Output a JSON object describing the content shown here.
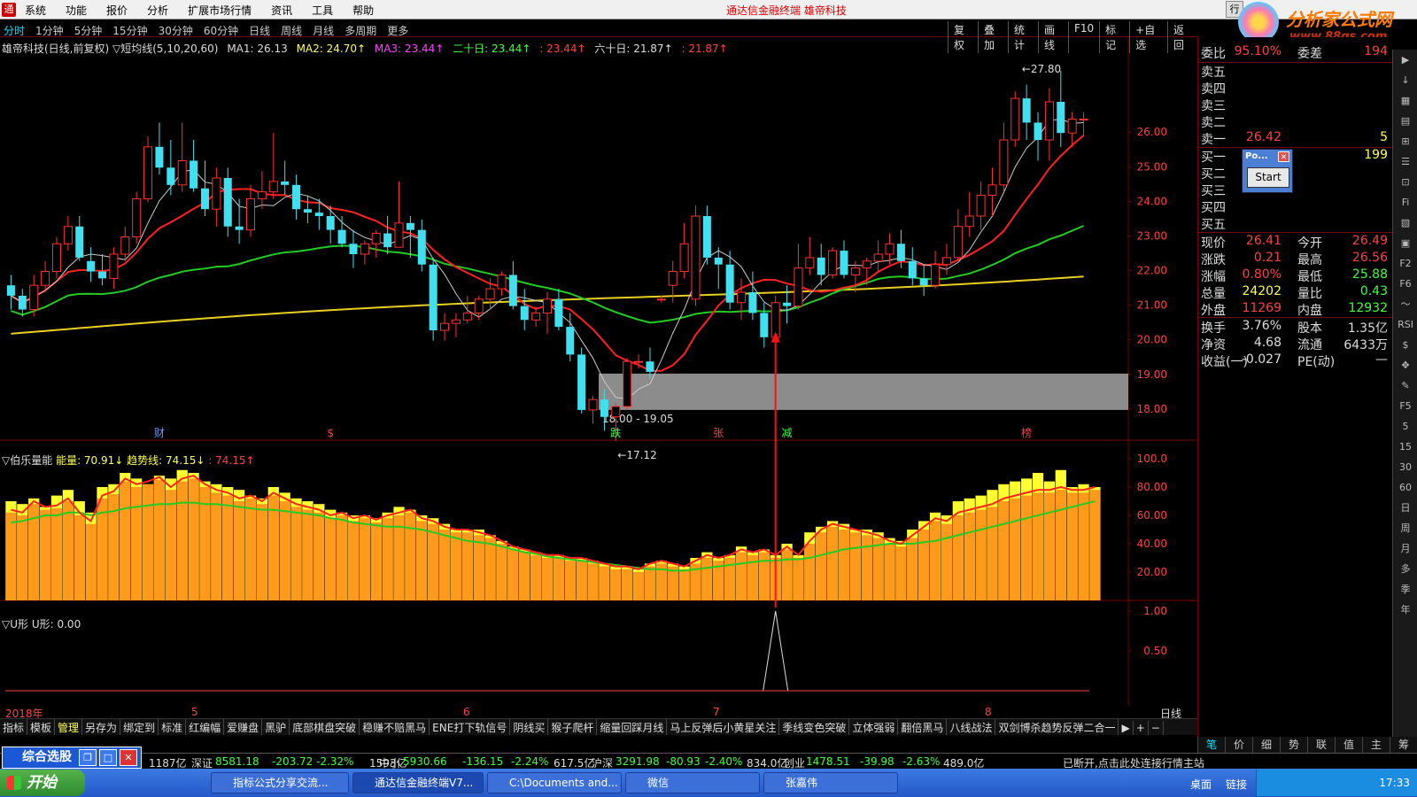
{
  "titlebar": {
    "menu": [
      "系统",
      "功能",
      "报价",
      "分析",
      "扩展市场行情",
      "资讯",
      "工具",
      "帮助"
    ],
    "title": "通达信金融终端  雄帝科技",
    "right_label": "行"
  },
  "brand": {
    "name": "分析家公式网",
    "url": "www.88gs.com"
  },
  "tabrow": {
    "periods": [
      "分时",
      "1分钟",
      "5分钟",
      "15分钟",
      "30分钟",
      "60分钟",
      "日线",
      "周线",
      "月线",
      "多周期",
      "更多"
    ],
    "ops": [
      "复权",
      "叠加",
      "统计",
      "画线",
      "F10",
      "标记",
      "+自选",
      "返回"
    ]
  },
  "chart_info": {
    "title": "雄帝科技(日线,前复权) ▽短均线(5,10,20,60)",
    "ma1": "MA1: 26.13",
    "ma2": "MA2: 24.70↑",
    "ma3": "MA3: 23.44↑",
    "ma20": "二十日: 23.44↑",
    "ma20b": ": 23.44↑",
    "ma60": "六十日: 21.87↑",
    "ma60b": ": 21.87↑"
  },
  "price_axis": [
    "26.00",
    "25.00",
    "24.00",
    "23.00",
    "22.00",
    "21.00",
    "20.00",
    "19.00",
    "18.00"
  ],
  "annotations": {
    "high": "27.80",
    "low": "17.12",
    "zone": "18.00 - 19.05",
    "markers": [
      "财",
      "$",
      "跌",
      "张",
      "减",
      "榜"
    ]
  },
  "ind1": {
    "title": "▽伯乐量能",
    "energy": "能量: 70.91↓",
    "trend": "趋势线: 74.15↓",
    "trend2": ": 74.15↑",
    "axis": [
      "100.0",
      "80.00",
      "60.00",
      "40.00",
      "20.00"
    ]
  },
  "ind2": {
    "title": "▽U形",
    "value": "U形: 0.00",
    "axis": [
      "1.00",
      "0.50"
    ]
  },
  "dates": {
    "labels": [
      "2018年",
      "5",
      "6",
      "7",
      "8"
    ],
    "period": "日线"
  },
  "indicator_tabs": [
    "指标",
    "模板",
    "管理",
    "另存为",
    "绑定到",
    "标准",
    "红编幅",
    "爱赚盘",
    "黑驴",
    "底部棋盘突破",
    "稳赚不赔黑马",
    "ENE打下轨信号",
    "阴线买",
    "猴子爬杆",
    "缩量回踩月线",
    "马上反弹后小黄星关注",
    "季线变色突破",
    "立体强弱",
    "翻倍黑马",
    "八线战法",
    "双剑博杀趋势反弹二合一",
    "▶",
    "+",
    "−"
  ],
  "quote": {
    "weibi": {
      "label": "委比",
      "value": "95.10%",
      "label2": "委差",
      "value2": "194"
    },
    "sell": [
      {
        "label": "卖五",
        "price": "",
        "vol": ""
      },
      {
        "label": "卖四",
        "price": "",
        "vol": ""
      },
      {
        "label": "卖三",
        "price": "",
        "vol": ""
      },
      {
        "label": "卖二",
        "price": "",
        "vol": ""
      },
      {
        "label": "卖一",
        "price": "26.42",
        "vol": "5"
      }
    ],
    "buy": [
      {
        "label": "买一",
        "price": "",
        "vol": "199"
      },
      {
        "label": "买二",
        "price": "",
        "vol": ""
      },
      {
        "label": "买三",
        "price": "",
        "vol": ""
      },
      {
        "label": "买四",
        "price": "",
        "vol": ""
      },
      {
        "label": "买五",
        "price": "",
        "vol": ""
      }
    ],
    "stats": [
      {
        "l": "现价",
        "v": "26.41",
        "l2": "今开",
        "v2": "26.49",
        "c": "#ff4040",
        "c2": "#ff4040"
      },
      {
        "l": "涨跌",
        "v": "0.21",
        "l2": "最高",
        "v2": "26.56",
        "c": "#ff4040",
        "c2": "#ff4040"
      },
      {
        "l": "涨幅",
        "v": "0.80%",
        "l2": "最低",
        "v2": "25.88",
        "c": "#ff4040",
        "c2": "#40ff40"
      },
      {
        "l": "总量",
        "v": "24202",
        "l2": "量比",
        "v2": "0.43",
        "c": "#ffff55",
        "c2": "#40ff40"
      },
      {
        "l": "外盘",
        "v": "11269",
        "l2": "内盘",
        "v2": "12932",
        "c": "#ff4040",
        "c2": "#40ff40"
      }
    ],
    "stats2": [
      {
        "l": "换手",
        "v": "3.76%",
        "l2": "股本",
        "v2": "1.35亿",
        "c": "#ddd",
        "c2": "#ddd"
      },
      {
        "l": "净资",
        "v": "4.68",
        "l2": "流通",
        "v2": "6433万",
        "c": "#ddd",
        "c2": "#ddd"
      },
      {
        "l": "收益(一)",
        "v": "-0.027",
        "l2": "PE(动)",
        "v2": "—",
        "c": "#ddd",
        "c2": "#ddd"
      }
    ]
  },
  "popup": {
    "title": "Po...",
    "button": "Start"
  },
  "right_tools": [
    "▶",
    "↓",
    "▦",
    "▤",
    "⊞",
    "☰",
    "⊡",
    "Fi",
    "▧",
    "▣",
    "F2",
    "F6",
    "〜",
    "RSI",
    "$",
    "✥",
    "✎",
    "F5",
    "5",
    "15",
    "30",
    "60",
    "日",
    "周",
    "月",
    "多",
    "季",
    "年"
  ],
  "quote_tabs": [
    "笔",
    "价",
    "细",
    "势",
    "联",
    "值",
    "主",
    "筹"
  ],
  "ticker": [
    {
      "t": "1187亿",
      "c": "#ddd"
    },
    {
      "t": "深证",
      "c": "#ddd"
    },
    {
      "t": "8581.18",
      "c": "#40ff40"
    },
    {
      "t": "-203.72",
      "c": "#40ff40"
    },
    {
      "t": "-2.32%",
      "c": "#40ff40"
    },
    {
      "t": "1593亿",
      "c": "#ddd"
    },
    {
      "t": "中小",
      "c": "#ddd"
    },
    {
      "t": "5930.66",
      "c": "#40ff40"
    },
    {
      "t": "-136.15",
      "c": "#40ff40"
    },
    {
      "t": "-2.24%",
      "c": "#40ff40"
    },
    {
      "t": "617.5亿",
      "c": "#ddd"
    },
    {
      "t": "沪深",
      "c": "#ddd"
    },
    {
      "t": "3291.98",
      "c": "#40ff40"
    },
    {
      "t": "-80.93",
      "c": "#40ff40"
    },
    {
      "t": "-2.40%",
      "c": "#40ff40"
    },
    {
      "t": "834.0亿",
      "c": "#ddd"
    },
    {
      "t": "创业",
      "c": "#ddd"
    },
    {
      "t": "1478.51",
      "c": "#40ff40"
    },
    {
      "t": "-39.98",
      "c": "#40ff40"
    },
    {
      "t": "-2.63%",
      "c": "#40ff40"
    },
    {
      "t": "489.0亿",
      "c": "#ddd"
    },
    {
      "t": "已断开,点击此处连接行情主站",
      "c": "#ddd"
    }
  ],
  "xuangu": {
    "title": "综合选股"
  },
  "taskbar": {
    "start": "开始",
    "tasks": [
      "指标公式分享交流...",
      "通达信金融终端V7...",
      "C:\\Documents and...",
      "微信",
      "张嘉伟"
    ],
    "tray_labels": [
      "桌面",
      "链接"
    ],
    "clock": "17:33"
  },
  "chart_data": {
    "type": "candlestick",
    "price_range": [
      17.0,
      28.0
    ],
    "candles": [
      [
        21.6,
        21.9,
        20.9,
        21.3
      ],
      [
        21.3,
        21.5,
        20.7,
        20.9
      ],
      [
        20.9,
        21.9,
        20.7,
        21.6
      ],
      [
        21.6,
        22.3,
        21.4,
        22.0
      ],
      [
        22.0,
        23.0,
        21.8,
        22.8
      ],
      [
        22.8,
        23.6,
        22.6,
        23.3
      ],
      [
        23.3,
        23.6,
        22.3,
        22.4
      ],
      [
        22.3,
        22.7,
        21.7,
        22.0
      ],
      [
        22.0,
        22.5,
        21.6,
        21.8
      ],
      [
        21.8,
        22.7,
        21.5,
        22.5
      ],
      [
        22.5,
        23.3,
        22.3,
        23.0
      ],
      [
        23.0,
        24.3,
        22.8,
        24.1
      ],
      [
        24.1,
        25.9,
        24.0,
        25.6
      ],
      [
        25.6,
        26.3,
        24.8,
        25.0
      ],
      [
        25.0,
        25.8,
        24.2,
        24.5
      ],
      [
        24.5,
        26.3,
        24.3,
        25.2
      ],
      [
        25.2,
        25.8,
        24.3,
        24.4
      ],
      [
        24.4,
        25.2,
        23.6,
        23.8
      ],
      [
        23.8,
        25.0,
        23.3,
        24.7
      ],
      [
        24.7,
        25.0,
        23.0,
        23.3
      ],
      [
        23.3,
        24.1,
        22.8,
        23.2
      ],
      [
        23.2,
        24.5,
        23.0,
        24.1
      ],
      [
        24.1,
        24.9,
        23.8,
        24.3
      ],
      [
        24.3,
        26.0,
        24.1,
        24.6
      ],
      [
        24.6,
        25.2,
        24.2,
        24.5
      ],
      [
        24.5,
        24.8,
        23.5,
        23.8
      ],
      [
        23.8,
        24.2,
        23.4,
        23.7
      ],
      [
        23.7,
        24.1,
        23.2,
        23.6
      ],
      [
        23.6,
        23.9,
        22.8,
        23.2
      ],
      [
        23.2,
        23.6,
        22.7,
        22.8
      ],
      [
        22.8,
        23.2,
        22.1,
        22.5
      ],
      [
        22.5,
        22.9,
        22.2,
        22.8
      ],
      [
        22.8,
        23.2,
        22.4,
        23.1
      ],
      [
        23.1,
        23.6,
        22.5,
        22.7
      ],
      [
        22.7,
        24.6,
        22.7,
        23.4
      ],
      [
        23.4,
        23.6,
        22.4,
        23.2
      ],
      [
        23.2,
        23.5,
        22.0,
        22.2
      ],
      [
        22.2,
        22.4,
        20.0,
        20.3
      ],
      [
        20.3,
        20.8,
        20.0,
        20.5
      ],
      [
        20.5,
        20.8,
        20.1,
        20.6
      ],
      [
        20.6,
        21.3,
        20.5,
        20.8
      ],
      [
        20.8,
        21.3,
        20.6,
        21.2
      ],
      [
        21.2,
        21.8,
        20.9,
        21.5
      ],
      [
        21.5,
        22.0,
        21.3,
        21.9
      ],
      [
        21.9,
        22.3,
        20.9,
        21.0
      ],
      [
        21.0,
        21.5,
        20.3,
        20.6
      ],
      [
        20.6,
        21.0,
        20.4,
        20.8
      ],
      [
        20.8,
        21.4,
        20.2,
        21.2
      ],
      [
        21.2,
        21.5,
        20.3,
        20.4
      ],
      [
        20.4,
        20.8,
        19.4,
        19.6
      ],
      [
        19.6,
        19.8,
        17.9,
        18.0
      ],
      [
        18.0,
        18.4,
        17.6,
        18.3
      ],
      [
        18.3,
        18.6,
        17.4,
        17.8
      ],
      [
        17.8,
        18.2,
        17.1,
        18.1
      ],
      [
        18.1,
        19.5,
        18.0,
        19.4
      ],
      [
        19.4,
        19.6,
        19.2,
        19.4
      ],
      [
        19.4,
        19.8,
        18.9,
        19.1
      ],
      [
        21.2,
        21.3,
        21.1,
        21.2
      ],
      [
        21.6,
        22.3,
        21.1,
        22.0
      ],
      [
        22.0,
        23.4,
        21.8,
        22.8
      ],
      [
        21.2,
        23.9,
        21.0,
        23.6
      ],
      [
        23.6,
        23.9,
        22.2,
        22.4
      ],
      [
        22.4,
        22.7,
        21.5,
        22.2
      ],
      [
        22.2,
        22.6,
        20.9,
        21.1
      ],
      [
        21.1,
        21.8,
        20.6,
        21.4
      ],
      [
        21.4,
        22.0,
        20.6,
        20.8
      ],
      [
        20.8,
        21.1,
        19.8,
        20.1
      ],
      [
        20.1,
        21.3,
        19.4,
        21.1
      ],
      [
        21.1,
        21.6,
        20.5,
        21.0
      ],
      [
        21.0,
        22.8,
        20.9,
        22.1
      ],
      [
        22.1,
        23.0,
        21.9,
        22.4
      ],
      [
        22.4,
        22.8,
        21.6,
        21.9
      ],
      [
        21.9,
        22.7,
        21.8,
        22.6
      ],
      [
        22.6,
        22.9,
        21.8,
        21.9
      ],
      [
        21.9,
        22.3,
        21.4,
        22.1
      ],
      [
        22.1,
        22.4,
        21.6,
        22.3
      ],
      [
        22.3,
        22.9,
        22.0,
        22.5
      ],
      [
        22.5,
        23.1,
        22.2,
        22.8
      ],
      [
        22.8,
        23.2,
        22.1,
        22.3
      ],
      [
        22.3,
        22.7,
        21.6,
        21.8
      ],
      [
        21.8,
        22.2,
        21.3,
        21.6
      ],
      [
        21.6,
        22.6,
        21.5,
        22.2
      ],
      [
        22.2,
        22.8,
        21.9,
        22.4
      ],
      [
        22.4,
        23.8,
        22.3,
        23.3
      ],
      [
        23.3,
        24.3,
        23.0,
        23.6
      ],
      [
        23.6,
        24.6,
        23.2,
        24.2
      ],
      [
        24.2,
        25.0,
        23.6,
        24.5
      ],
      [
        24.5,
        26.3,
        24.3,
        25.8
      ],
      [
        25.8,
        27.2,
        25.6,
        27.0
      ],
      [
        27.0,
        27.4,
        25.8,
        26.3
      ],
      [
        26.3,
        26.6,
        25.2,
        25.8
      ],
      [
        25.8,
        27.3,
        25.2,
        26.9
      ],
      [
        26.9,
        27.8,
        25.6,
        26.0
      ],
      [
        26.0,
        26.6,
        25.6,
        26.4
      ],
      [
        26.4,
        26.6,
        25.9,
        26.4
      ]
    ],
    "ma_series": [
      {
        "name": "MA1",
        "color": "#ddd",
        "period": 5
      },
      {
        "name": "MA2",
        "color": "#ffff55",
        "period": 10
      },
      {
        "name": "二十日",
        "color": "#40ff40",
        "period": 20
      },
      {
        "name": "六十日",
        "color": "#e00000",
        "period": 60
      }
    ],
    "zone": [
      18.0,
      19.05
    ],
    "energy_range": [
      0,
      110
    ],
    "energy": [
      62,
      60,
      68,
      64,
      65,
      70,
      60,
      54,
      72,
      75,
      84,
      80,
      82,
      85,
      78,
      84,
      86,
      80,
      76,
      74,
      70,
      72,
      68,
      74,
      70,
      66,
      64,
      62,
      58,
      60,
      56,
      58,
      55,
      58,
      60,
      62,
      56,
      54,
      50,
      48,
      48,
      46,
      44,
      40,
      36,
      34,
      32,
      30,
      30,
      28,
      28,
      26,
      24,
      22,
      22,
      20,
      24,
      26,
      24,
      22,
      26,
      30,
      28,
      30,
      34,
      32,
      34,
      30,
      36,
      30,
      40,
      48,
      52,
      50,
      48,
      46,
      44,
      40,
      38,
      44,
      50,
      56,
      54,
      60,
      62,
      64,
      66,
      70,
      72,
      74,
      76,
      76,
      78,
      76,
      76,
      78
    ],
    "energy_hi": [
      70,
      68,
      72,
      66,
      74,
      78,
      70,
      62,
      80,
      82,
      90,
      86,
      82,
      88,
      86,
      92,
      90,
      84,
      82,
      80,
      78,
      74,
      72,
      80,
      76,
      72,
      70,
      68,
      64,
      62,
      60,
      60,
      58,
      62,
      66,
      64,
      60,
      58,
      54,
      50,
      50,
      50,
      46,
      42,
      38,
      36,
      34,
      32,
      32,
      30,
      30,
      28,
      26,
      24,
      24,
      22,
      26,
      28,
      26,
      24,
      30,
      34,
      30,
      32,
      38,
      34,
      36,
      32,
      40,
      32,
      48,
      52,
      56,
      54,
      50,
      50,
      48,
      44,
      42,
      50,
      56,
      62,
      60,
      70,
      72,
      74,
      78,
      82,
      84,
      86,
      90,
      84,
      92,
      80,
      82,
      80
    ],
    "trend": [
      55,
      56,
      58,
      60,
      60,
      62,
      62,
      60,
      62,
      63,
      65,
      66,
      67,
      68,
      68,
      69,
      69,
      68,
      68,
      67,
      66,
      65,
      64,
      64,
      63,
      62,
      61,
      60,
      58,
      57,
      55,
      54,
      53,
      52,
      52,
      51,
      50,
      48,
      46,
      44,
      42,
      41,
      40,
      38,
      36,
      34,
      33,
      31,
      30,
      29,
      28,
      27,
      26,
      25,
      24,
      23,
      22,
      22,
      21,
      21,
      22,
      23,
      24,
      25,
      26,
      27,
      28,
      28,
      29,
      29,
      30,
      32,
      34,
      36,
      37,
      38,
      39,
      40,
      40,
      40,
      41,
      42,
      44,
      46,
      48,
      50,
      52,
      54,
      56,
      58,
      60,
      62,
      64,
      66,
      68,
      70
    ],
    "u_shape": {
      "x_index": 67,
      "value": 1.0
    }
  }
}
